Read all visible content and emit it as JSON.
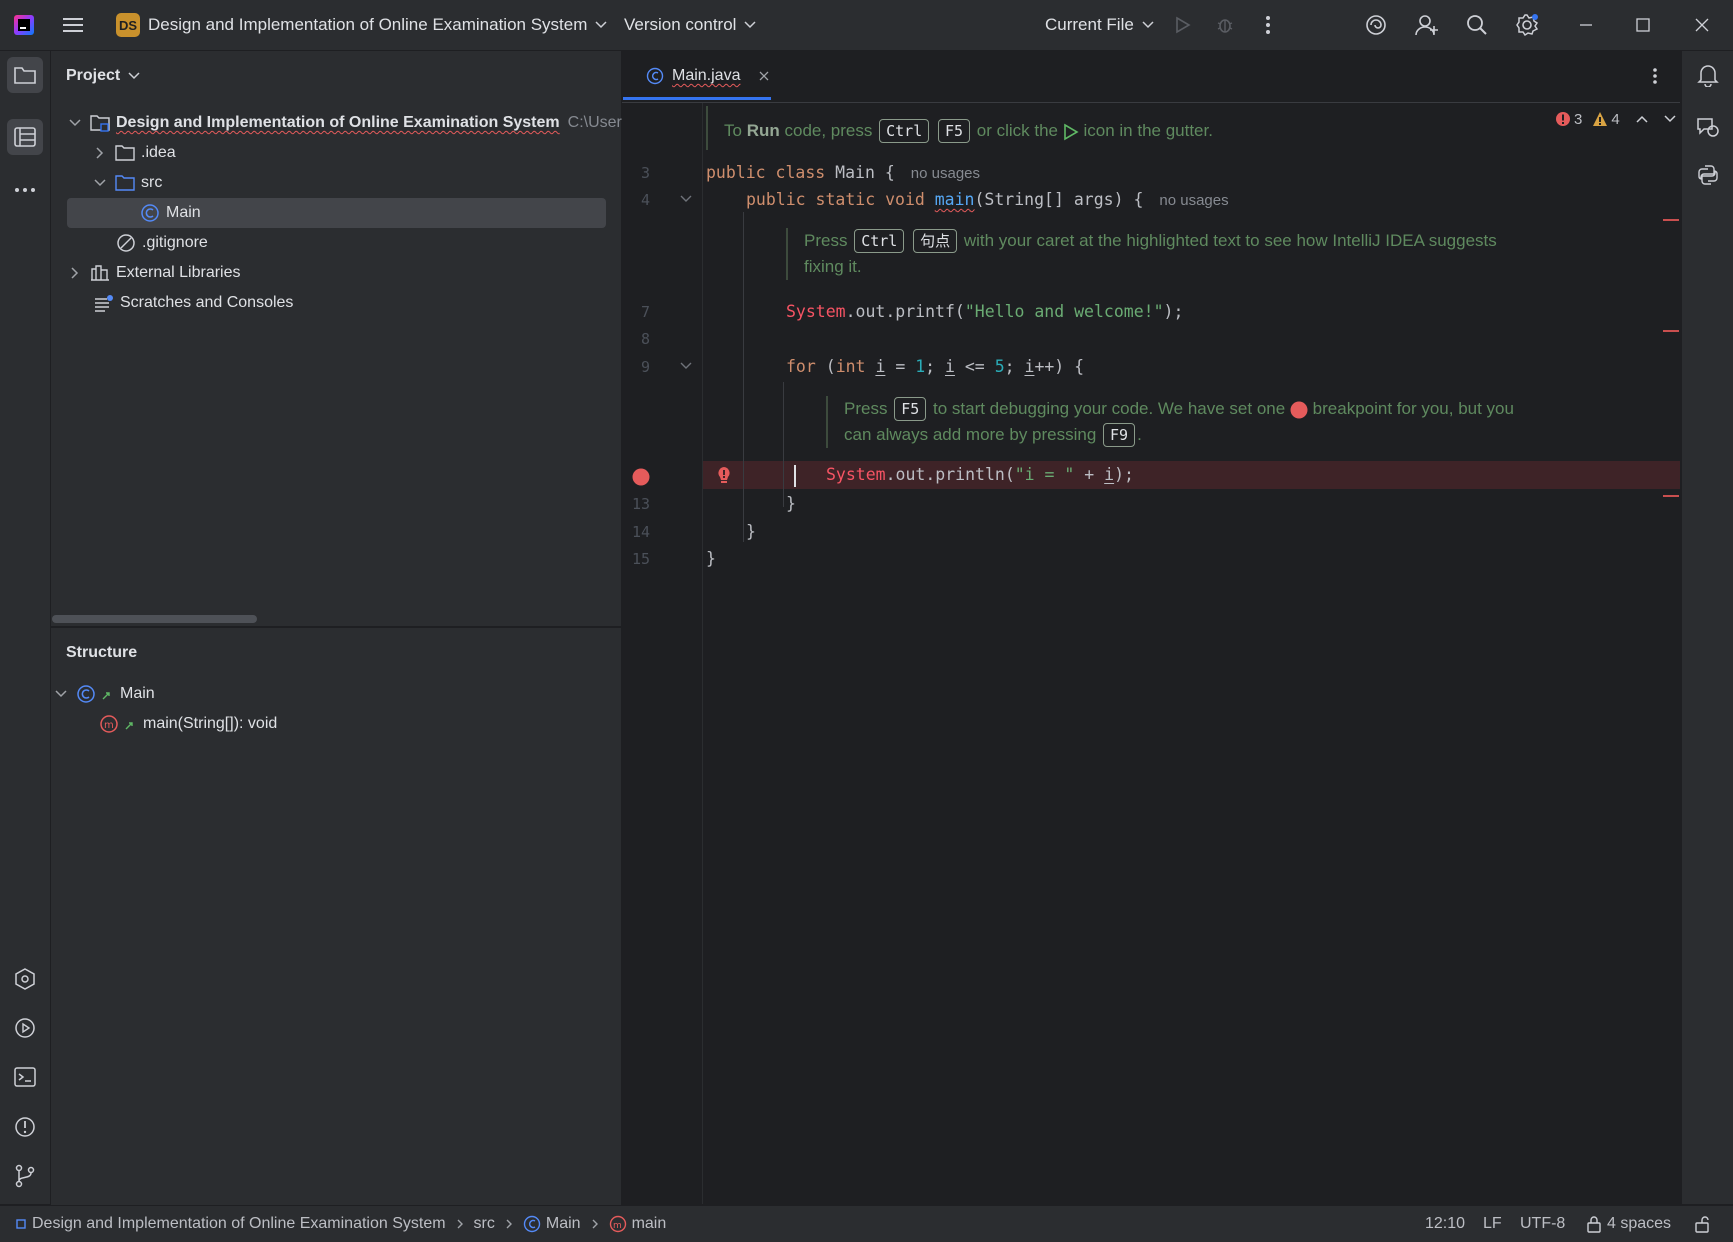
{
  "titlebar": {
    "project_badge": "DS",
    "project_name": "Design and Implementation of Online Examination System",
    "version_control": "Version control",
    "run_config": "Current File"
  },
  "project_panel": {
    "title": "Project",
    "root_name": "Design and Implementation of Online Examination System",
    "root_path": "C:\\Users",
    "items": [
      {
        "label": ".idea"
      },
      {
        "label": "src"
      },
      {
        "label": "Main"
      },
      {
        "label": ".gitignore"
      },
      {
        "label": "External Libraries"
      },
      {
        "label": "Scratches and Consoles"
      }
    ]
  },
  "structure_panel": {
    "title": "Structure",
    "class_name": "Main",
    "method": "main(String[]): void"
  },
  "editor": {
    "tab_label": "Main.java",
    "inspections": {
      "errors": "3",
      "warnings": "4"
    },
    "line_numbers": [
      "3",
      "4",
      "7",
      "8",
      "9",
      "13",
      "14",
      "15"
    ],
    "doc1": {
      "pre": "To",
      "bold": "Run",
      "mid": "code, press",
      "key1": "Ctrl",
      "key2": "F5",
      "post": "or click the",
      "post2": "icon in the gutter."
    },
    "code3": {
      "kw1": "public class",
      "name": "Main",
      "brace": "{",
      "hint": "no usages"
    },
    "code4": {
      "kw": "public static void",
      "fn": "main",
      "args": "(String[] args)",
      "brace": "{",
      "hint": "no usages"
    },
    "doc2": {
      "pre": "Press",
      "key1": "Ctrl",
      "key2": "句点",
      "post": "with your caret at the highlighted text to see how IntelliJ IDEA suggests",
      "line2": "fixing it."
    },
    "code7": {
      "err": "System",
      "mid": ".out.printf(",
      "str": "\"Hello and welcome!\"",
      "end": ");"
    },
    "code9": {
      "kw": "for",
      "p1": "(",
      "kw2": "int",
      "v1": "i",
      "eq": "=",
      "n1": "1",
      "semi1": ";",
      "v2": "i",
      "lte": "<=",
      "n2": "5",
      "semi2": ";",
      "v3": "i",
      "inc": "++) {"
    },
    "doc3": {
      "pre": "Press",
      "key1": "F5",
      "mid": "to start debugging your code. We have set one",
      "post": "breakpoint for you, but you",
      "line2": "can always add more by pressing",
      "key2": "F9",
      "end": "."
    },
    "code12": {
      "err": "System",
      "mid": ".out.println(",
      "str": "\"i = \"",
      "plus": " + ",
      "v": "i",
      "end": ");"
    },
    "code13": "}",
    "code14": "}",
    "code15": "}"
  },
  "statusbar": {
    "project": "Design and Implementation of Online Examination System",
    "src": "src",
    "class": "Main",
    "method": "main",
    "position": "12:10",
    "line_sep": "LF",
    "encoding": "UTF-8",
    "indent": "4 spaces"
  },
  "colors": {
    "accent": "#3574f0",
    "error": "#f75464",
    "keyword": "#cf8e6d",
    "string": "#6aab73",
    "number": "#2aacb8"
  }
}
